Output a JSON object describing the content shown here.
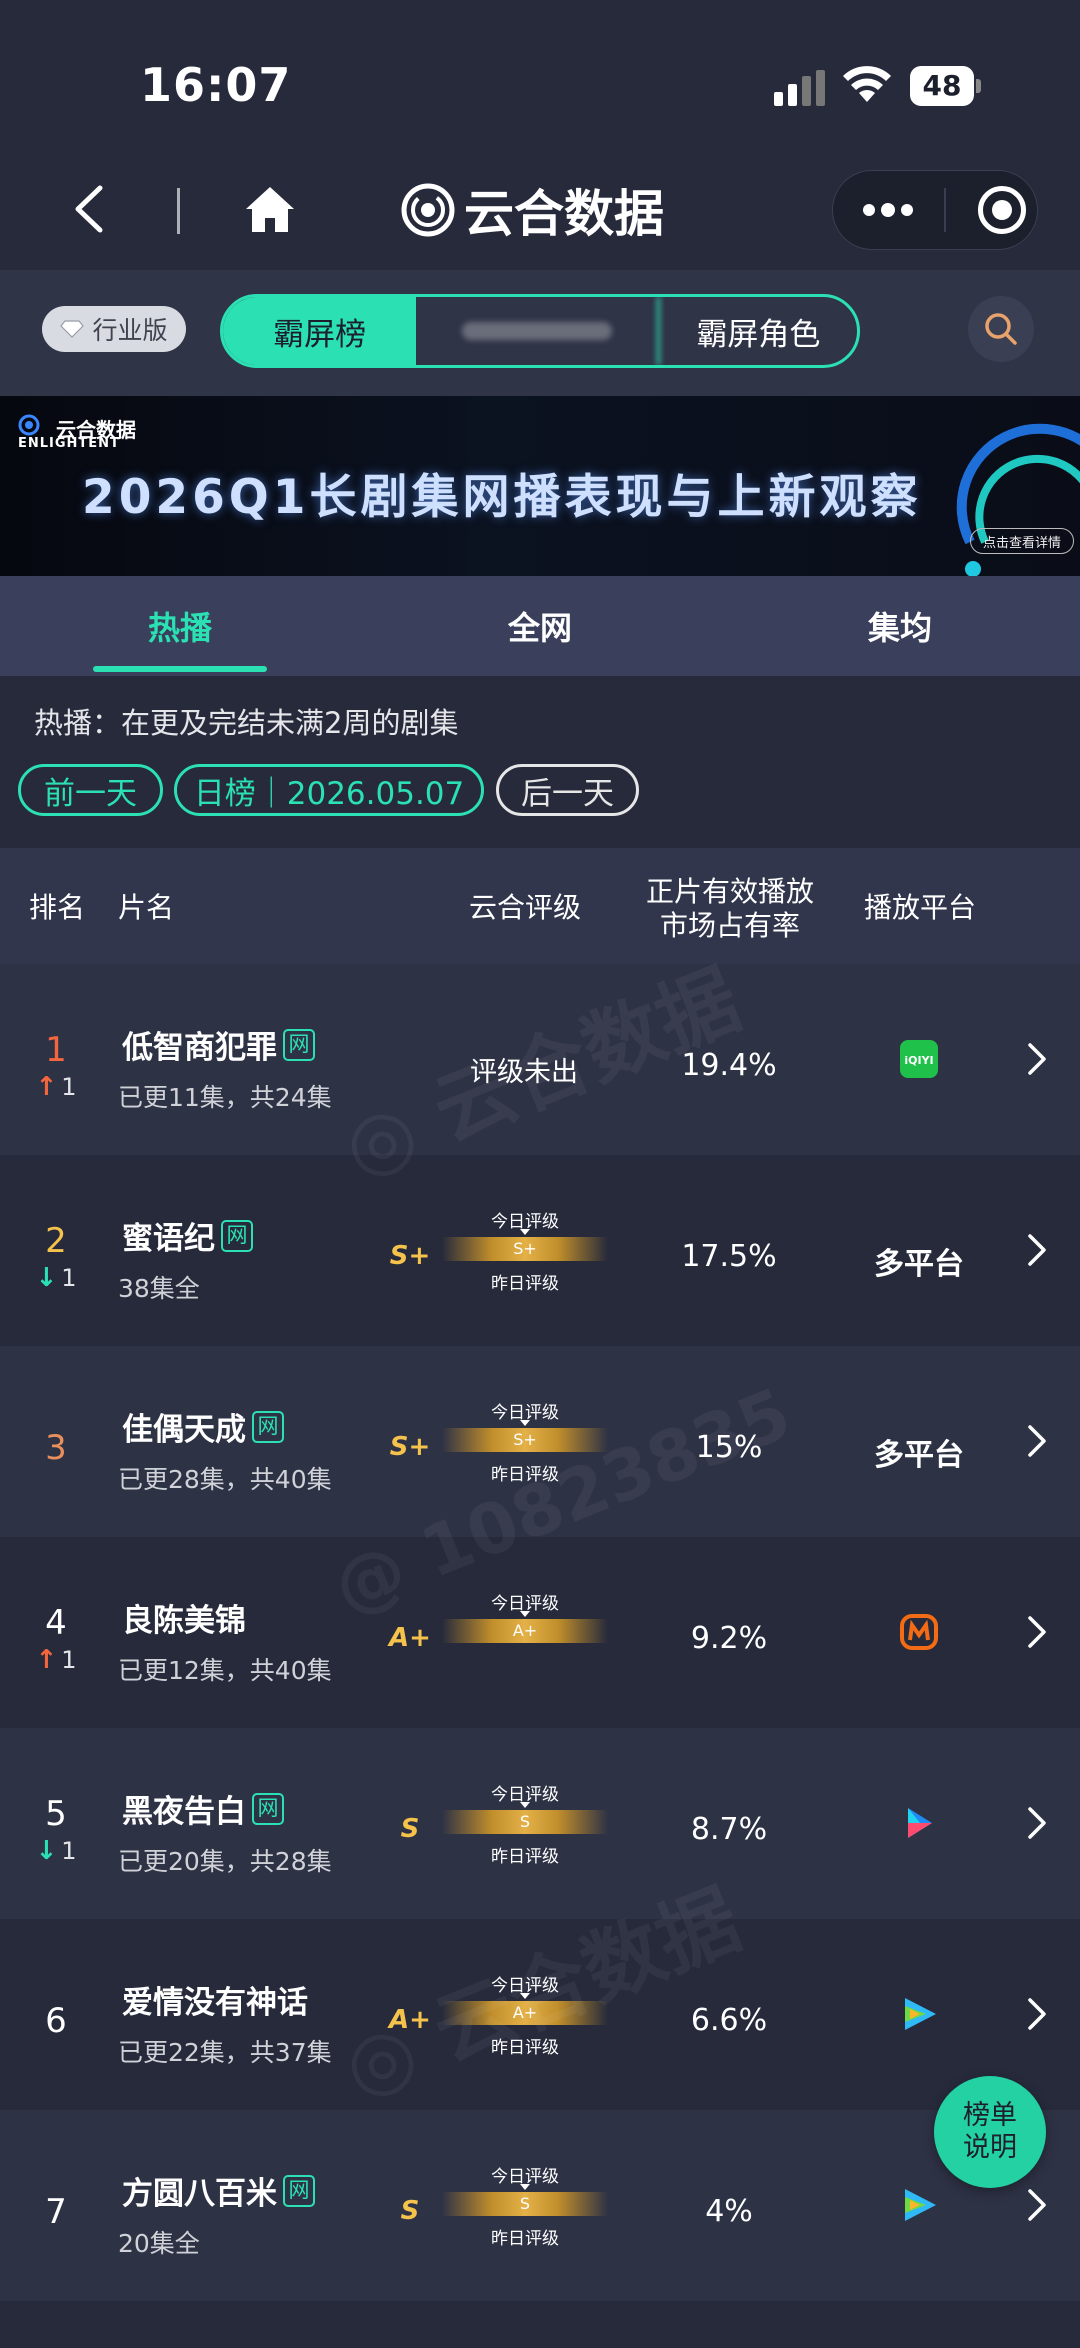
{
  "status_bar": {
    "time": "16:07",
    "battery": "48"
  },
  "nav": {
    "app_title": "云合数据"
  },
  "filter": {
    "industry_label": "行业版",
    "segments": [
      "霸屏榜",
      "",
      "霸屏角色"
    ]
  },
  "banner": {
    "logo_cn": "云合数据",
    "logo_en": "ENLIGHTENT",
    "title": "2026Q1长剧集网播表现与上新观察",
    "cta": "点击查看详情"
  },
  "tabs": [
    "热播",
    "全网",
    "集均"
  ],
  "description": "热播：在更及完结未满2周的剧集",
  "date_nav": {
    "prev": "前一天",
    "day": "日榜｜2026.05.07",
    "next": "后一天"
  },
  "table": {
    "headers": {
      "rank": "排名",
      "name": "片名",
      "grade": "云合评级",
      "share_line1": "正片有效播放",
      "share_line2": "市场占有率",
      "platform": "播放平台"
    },
    "net_badge": "网",
    "today_label": "今日评级",
    "yesterday_label": "昨日评级",
    "rows": [
      {
        "rank": "1",
        "rank_color": "#f4673e",
        "change_dir": "up",
        "change": "1",
        "title": "低智商犯罪",
        "net": true,
        "episodes": "已更11集，共24集",
        "grade_text": "评级未出",
        "grade": "",
        "today": "",
        "share": "19.4%",
        "platform": "iqiyi-icon",
        "platform_text": "iQIYI"
      },
      {
        "rank": "2",
        "rank_color": "#f5c24c",
        "change_dir": "down",
        "change": "1",
        "title": "蜜语纪",
        "net": true,
        "episodes": "38集全",
        "grade_text": "",
        "grade": "S+",
        "today": "S+",
        "share": "17.5%",
        "platform": "multi",
        "platform_text": "多平台"
      },
      {
        "rank": "3",
        "rank_color": "#e88f5c",
        "change_dir": "",
        "change": "",
        "title": "佳偶天成",
        "net": true,
        "episodes": "已更28集，共40集",
        "grade_text": "",
        "grade": "S+",
        "today": "S+",
        "share": "15%",
        "platform": "multi",
        "platform_text": "多平台"
      },
      {
        "rank": "4",
        "rank_color": "#ffffff",
        "change_dir": "up",
        "change": "1",
        "title": "良陈美锦",
        "net": false,
        "episodes": "已更12集，共40集",
        "grade_text": "",
        "grade": "A+",
        "today": "A+",
        "share": "9.2%",
        "platform": "mango-icon",
        "platform_text": ""
      },
      {
        "rank": "5",
        "rank_color": "#ffffff",
        "change_dir": "down",
        "change": "1",
        "title": "黑夜告白",
        "net": true,
        "episodes": "已更20集，共28集",
        "grade_text": "",
        "grade": "S",
        "today": "S",
        "share": "8.7%",
        "platform": "youku-icon",
        "platform_text": ""
      },
      {
        "rank": "6",
        "rank_color": "#ffffff",
        "change_dir": "",
        "change": "",
        "title": "爱情没有神话",
        "net": false,
        "episodes": "已更22集，共37集",
        "grade_text": "",
        "grade": "A+",
        "today": "A+",
        "share": "6.6%",
        "platform": "tencent-video-icon",
        "platform_text": ""
      },
      {
        "rank": "7",
        "rank_color": "#ffffff",
        "change_dir": "",
        "change": "",
        "title": "方圆八百米",
        "net": true,
        "episodes": "20集全",
        "grade_text": "",
        "grade": "S",
        "today": "S",
        "share": "4%",
        "platform": "tencent-video-icon",
        "platform_text": ""
      }
    ]
  },
  "help_button": {
    "line1": "榜单",
    "line2": "说明"
  },
  "colors": {
    "accent": "#2be0b2",
    "background": "#262a3b",
    "rise": "#f4673e",
    "fall": "#2be0b2",
    "grade_gold": "#f5c24c"
  }
}
